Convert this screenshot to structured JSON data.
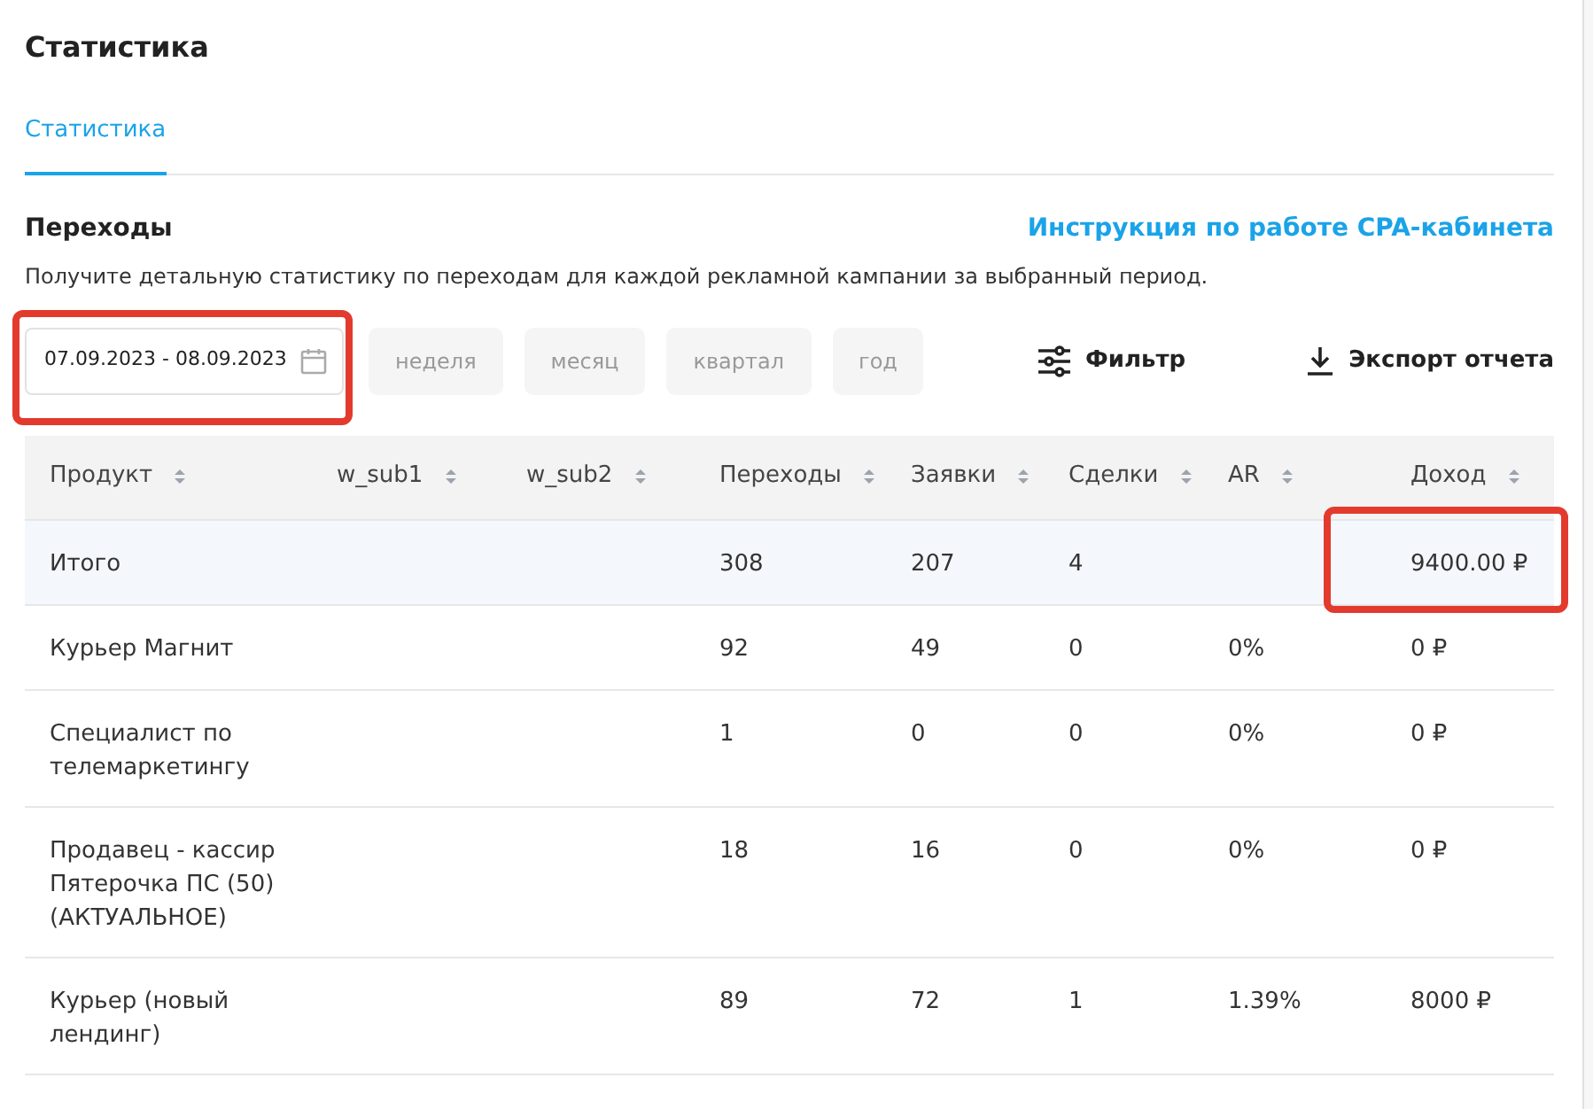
{
  "page_title": "Статистика",
  "tabs": [
    {
      "label": "Статистика",
      "selected": true
    }
  ],
  "section": {
    "title": "Переходы",
    "help_link": "Инструкция по работе CPA-кабинета",
    "description": "Получите детальную статистику по переходам для каждой рекламной кампании за выбранный период."
  },
  "date_range": {
    "value": "07.09.2023 - 08.09.2023",
    "highlighted": true
  },
  "periods": [
    {
      "label": "неделя",
      "selected": false
    },
    {
      "label": "месяц",
      "selected": false
    },
    {
      "label": "квартал",
      "selected": false
    },
    {
      "label": "год",
      "selected": false
    }
  ],
  "actions": [
    {
      "kind": "filter",
      "label": "Фильтр"
    },
    {
      "kind": "export",
      "label": "Экспорт отчета"
    }
  ],
  "table": {
    "columns": [
      "Продукт",
      "w_sub1",
      "w_sub2",
      "Переходы",
      "Заявки",
      "Сделки",
      "AR",
      "Доход"
    ],
    "rows": [
      {
        "kind": "total",
        "cells": [
          "Итого",
          "",
          "",
          "308",
          "207",
          "4",
          "",
          "9400.00 ₽"
        ],
        "income_highlighted": true
      },
      {
        "kind": "item",
        "cells": [
          "Курьер Магнит",
          "",
          "",
          "92",
          "49",
          "0",
          "0%",
          "0 ₽"
        ],
        "income_highlighted": false
      },
      {
        "kind": "item",
        "cells": [
          "Специалист по телемаркетингу",
          "",
          "",
          "1",
          "0",
          "0",
          "0%",
          "0 ₽"
        ],
        "income_highlighted": false
      },
      {
        "kind": "item",
        "cells": [
          "Продавец - кассир Пятерочка ПС (50) (АКТУАЛЬНОЕ)",
          "",
          "",
          "18",
          "16",
          "0",
          "0%",
          "0 ₽"
        ],
        "income_highlighted": false
      },
      {
        "kind": "item",
        "cells": [
          "Курьер (новый лендинг)",
          "",
          "",
          "89",
          "72",
          "1",
          "1.39%",
          "8000 ₽"
        ],
        "income_highlighted": false
      }
    ]
  }
}
